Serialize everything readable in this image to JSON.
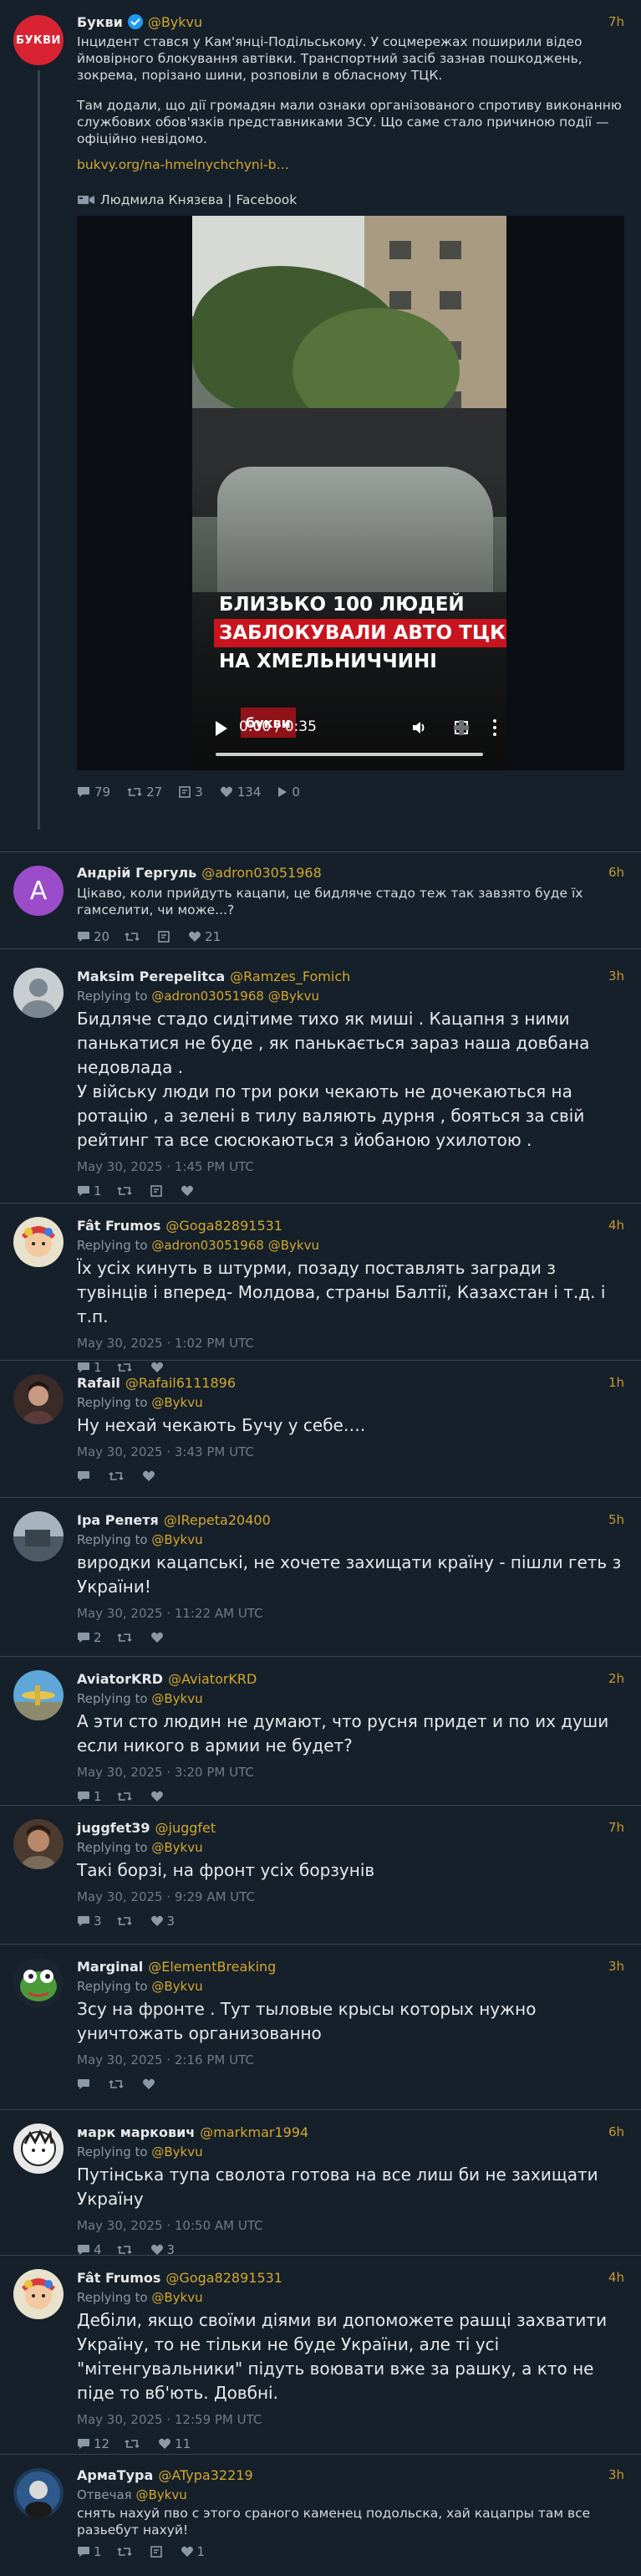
{
  "main": {
    "avatar_text": "БУКВИ",
    "name": "Букви",
    "handle": "@Bykvu",
    "time": "7h",
    "paragraph1": "Інцидент стався у Кам'янці-Подільському. У соцмережах поширили відео ймовірного блокування автівки. Транспортний засіб зазнав пошкоджень, зокрема, порізано шини, розповіли в обласному ТЦК.",
    "paragraph2": "Там додали, що дії громадян мали ознаки організованого спротиву виконанню службових обов'язків представниками ЗСУ. Що саме стало причиною події — офіційно невідомо.",
    "link": "bukvy.org/na-hmelnychchyni-b…",
    "credit": "Людмила Князєва | Facebook",
    "video": {
      "caption_line1": "БЛИЗЬКО 100 ЛЮДЕЙ",
      "caption_line2": "ЗАБЛОКУВАЛИ АВТО ТЦК",
      "caption_line3": "НА ХМЕЛЬНИЧЧИНІ",
      "watermark": "букви",
      "time": "0:00 / 0:35",
      "progress": 0
    },
    "stats": {
      "replies": "79",
      "retweets": "27",
      "quotes": "3",
      "likes": "134",
      "views": "0"
    }
  },
  "replies": [
    {
      "name": "Андрій Гергуль",
      "handle": "@adron03051968",
      "time": "6h",
      "avatar_letter": "A",
      "text": "Цікаво, коли прийдуть кацапи, це бидляче стадо теж так завзято буде їх гамселити, чи може...?",
      "replies": "20",
      "retweets": "",
      "likes": "21"
    },
    {
      "name": "Maksim Perepelitca",
      "handle": "@Ramzes_Fomich",
      "time": "3h",
      "replying_label": "Replying to",
      "replying_to": "@adron03051968 @Bykvu",
      "text": "Бидляче стадо сидітиме тихо як миші . Кацапня з ними панькатися не буде , як панькається зараз наша довбана недовлада .\nУ війську люди по три роки чекають не дочекаються на ротацію , а зелені в тилу валяють дурня  , бояться за свій рейтинг та все сюсюкаються з йобаною ухилотою .",
      "timestamp": "May 30, 2025 · 1:45 PM UTC",
      "replies": "1",
      "retweets": "",
      "likes": ""
    },
    {
      "name": "Fât Frumos",
      "handle": "@Goga82891531",
      "time": "4h",
      "replying_label": "Replying to",
      "replying_to": "@adron03051968 @Bykvu",
      "text": "Їх усіх кинуть в штурми, позаду поставлять загради з тувінців і вперед- Молдова, страны Балтії, Казахстан і т.д. і т.п.",
      "timestamp": "May 30, 2025 · 1:02 PM UTC",
      "replies": "1",
      "retweets": "",
      "likes": ""
    },
    {
      "name": "Rafail",
      "handle": "@Rafail6111896",
      "time": "1h",
      "replying_label": "Replying to",
      "replying_to": "@Bykvu",
      "text": "Ну нехай чекають Бучу у себе….",
      "timestamp": "May 30, 2025 · 3:43 PM UTC",
      "replies": "",
      "retweets": "",
      "likes": ""
    },
    {
      "name": "Іра Репетя",
      "handle": "@IRepeta20400",
      "time": "5h",
      "replying_label": "Replying to",
      "replying_to": "@Bykvu",
      "text": "виродки кацапські, не хочете захищати країну - пішли геть з України!",
      "timestamp": "May 30, 2025 · 11:22 AM UTC",
      "replies": "2",
      "retweets": "",
      "likes": ""
    },
    {
      "name": "AviatorKRD",
      "handle": "@AviatorKRD",
      "time": "2h",
      "replying_label": "Replying to",
      "replying_to": "@Bykvu",
      "text": "А эти сто людин не думают, что русня придет и по их души если никого в армии не будет?",
      "timestamp": "May 30, 2025 · 3:20 PM UTC",
      "replies": "1",
      "retweets": "",
      "likes": ""
    },
    {
      "name": "juggfet39",
      "handle": "@juggfet",
      "time": "7h",
      "replying_label": "Replying to",
      "replying_to": "@Bykvu",
      "text": "Такі борзі, на фронт усіх борзунів",
      "timestamp": "May 30, 2025 · 9:29 AM UTC",
      "replies": "3",
      "retweets": "",
      "likes": "3"
    },
    {
      "name": "Marginal",
      "handle": "@ElementBreaking",
      "time": "3h",
      "replying_label": "Replying to",
      "replying_to": "@Bykvu",
      "text": "Зсу на фронте . Тут тыловые крысы которых нужно уничтожать организованно",
      "timestamp": "May 30, 2025 · 2:16 PM UTC",
      "replies": "",
      "retweets": "",
      "likes": ""
    },
    {
      "name": "марк маркович",
      "handle": "@markmar1994",
      "time": "6h",
      "replying_label": "Replying to",
      "replying_to": "@Bykvu",
      "text": "Путінська тупа сволота готова на все лиш би не захищати Україну",
      "timestamp": "May 30, 2025 · 10:50 AM UTC",
      "replies": "4",
      "retweets": "",
      "likes": "3"
    },
    {
      "name": "Fât Frumos",
      "handle": "@Goga82891531",
      "time": "4h",
      "replying_label": "Replying to",
      "replying_to": "@Bykvu",
      "text": "Дебіли, якщо своїми діями ви допоможете рашці захватити Україну, то не тільки не буде України, але ті усі \"мітенгувальники\" підуть воювати вже за рашку,  а кто не піде то вб'ють. Довбні.",
      "timestamp": "May 30, 2025 · 12:59 PM UTC",
      "replies": "12",
      "retweets": "",
      "likes": "11"
    },
    {
      "name": "АрмаТура",
      "handle": "@ATypa32219",
      "time": "3h",
      "replying_label": "Отвечая",
      "replying_to": "@Bykvu",
      "text": "снять нахуй пво с этого сраного каменец подольска, хай кацапры там все разьебут нахуй!",
      "replies": "1",
      "retweets": "",
      "likes": "1"
    }
  ]
}
